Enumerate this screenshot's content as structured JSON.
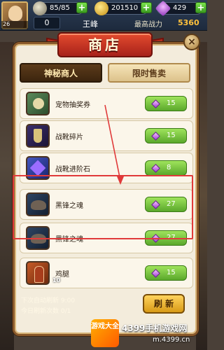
{
  "hud": {
    "level": "26",
    "stamina": "85/85",
    "coins": "201510",
    "gems": "429",
    "vip": "0",
    "player_name": "王峰",
    "power_label": "最高战力",
    "power_value": "5360"
  },
  "shop": {
    "title": "商店",
    "close": "×",
    "tabs": [
      {
        "label": "神秘商人",
        "active": true
      },
      {
        "label": "限时售卖",
        "active": false
      }
    ],
    "items": [
      {
        "name": "宠物抽奖券",
        "price": "15",
        "icon": "pet-ticket-icon"
      },
      {
        "name": "战靴碎片",
        "price": "15",
        "icon": "boots-fragment-icon"
      },
      {
        "name": "战靴进阶石",
        "price": "8",
        "icon": "boots-upgrade-stone-icon"
      },
      {
        "name": "黑锋之魂",
        "price": "27",
        "icon": "black-blade-soul-icon"
      },
      {
        "name": "黑锋之魂",
        "price": "27",
        "icon": "black-blade-soul-icon"
      },
      {
        "name": "鸡腿",
        "price": "15",
        "icon": "chicken-leg-icon",
        "count": "10"
      }
    ],
    "auto_refresh": "下次自动刷新  9:00",
    "refresh_count": "今日刷新次数   0/1",
    "refresh_button": "刷 新"
  },
  "watermark": {
    "logo": "游戏大全",
    "text": "4399手机游戏网",
    "url": "m.4399.cn"
  },
  "colors": {
    "accent": "#a8221a",
    "price_green": "#5aa82b",
    "highlight": "#e03a3a"
  }
}
